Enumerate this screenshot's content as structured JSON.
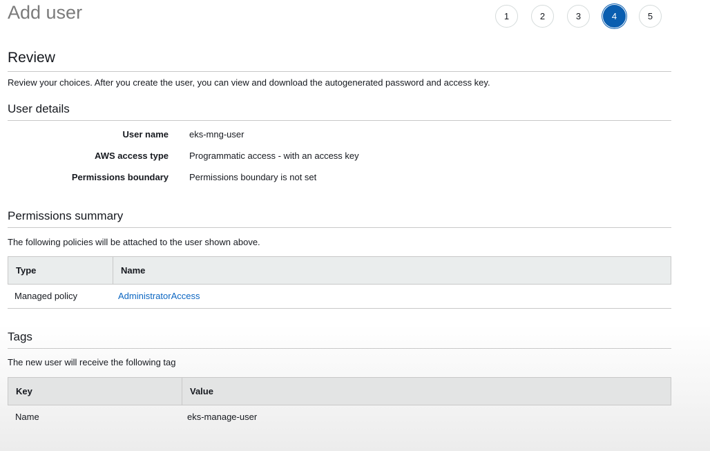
{
  "page": {
    "title": "Add user"
  },
  "steps": [
    {
      "label": "1",
      "active": false
    },
    {
      "label": "2",
      "active": false
    },
    {
      "label": "3",
      "active": false
    },
    {
      "label": "4",
      "active": true
    },
    {
      "label": "5",
      "active": false
    }
  ],
  "review": {
    "title": "Review",
    "description": "Review your choices. After you create the user, you can view and download the autogenerated password and access key."
  },
  "user_details": {
    "title": "User details",
    "rows": [
      {
        "label": "User name",
        "value": "eks-mng-user"
      },
      {
        "label": "AWS access type",
        "value": "Programmatic access - with an access key"
      },
      {
        "label": "Permissions boundary",
        "value": "Permissions boundary is not set"
      }
    ]
  },
  "permissions": {
    "title": "Permissions summary",
    "description": "The following policies will be attached to the user shown above.",
    "columns": [
      "Type",
      "Name"
    ],
    "rows": [
      {
        "type": "Managed policy",
        "name": "AdministratorAccess"
      }
    ]
  },
  "tags": {
    "title": "Tags",
    "description": "The new user will receive the following tag",
    "columns": [
      "Key",
      "Value"
    ],
    "rows": [
      {
        "key": "Name",
        "value": "eks-manage-user"
      }
    ]
  },
  "colors": {
    "active_step": "#0a5eb0",
    "link": "#0b66c2",
    "table_header_bg": "#eaeded"
  }
}
